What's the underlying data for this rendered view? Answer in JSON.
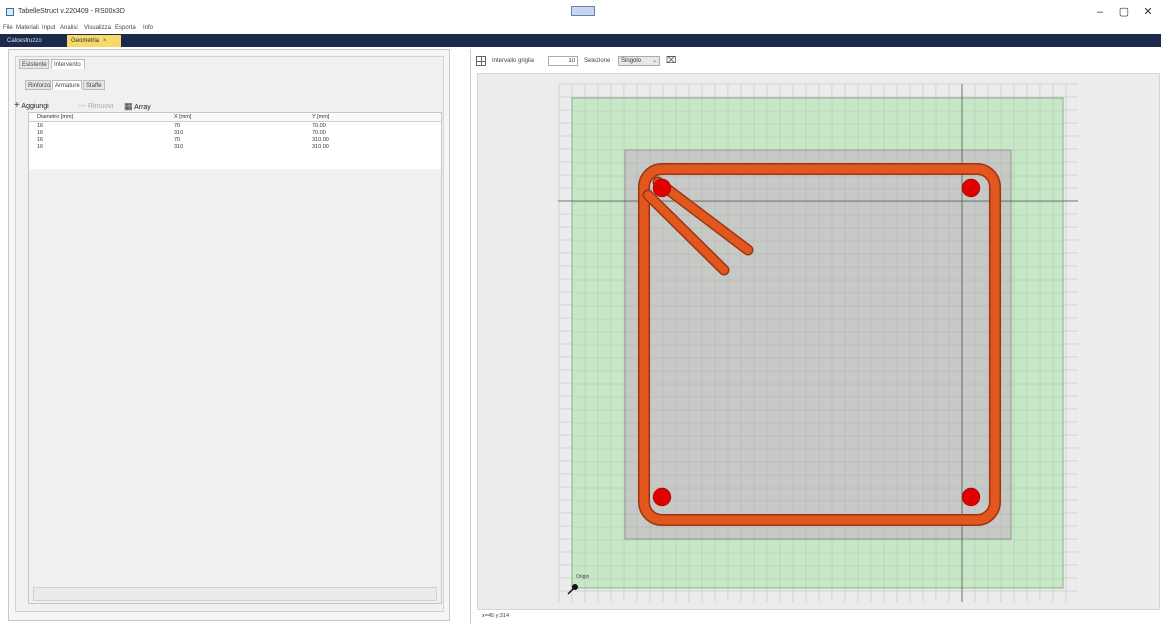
{
  "window": {
    "title": "TabelleStruct v.220409 - RS00x3D",
    "center_badge": "",
    "minimize": "–",
    "maximize": "▢",
    "close": "✕"
  },
  "menu": [
    "File",
    "Materiali",
    "Input",
    "Analisi",
    "Visualizza",
    "Esporta",
    "Info"
  ],
  "doc_tabs": {
    "calcestruzzo": "Calcestruzzo",
    "geometria": "Geometria",
    "geometria_close": "×"
  },
  "left": {
    "outer_tabs": [
      "Esistente",
      "Intervento"
    ],
    "inner_tabs": [
      "Rinforzo",
      "Armature",
      "Staffe"
    ],
    "toolbar": {
      "add": "Aggiungi",
      "remove": "Rimuovi",
      "array": "Array"
    },
    "table": {
      "columns": [
        "Diametro [mm]",
        "X [mm]",
        "Y [mm]"
      ],
      "rows": [
        [
          "16",
          "70",
          "70.00"
        ],
        [
          "16",
          "310",
          "70.00"
        ],
        [
          "16",
          "70",
          "310.00"
        ],
        [
          "16",
          "310",
          "310.00"
        ]
      ]
    }
  },
  "right": {
    "toolbar": {
      "grid_interval_label": "Intervallo griglia",
      "grid_interval_value": "10",
      "selection_label": "Selezione",
      "selection_value": "Singolo"
    },
    "origin_label": "Origin",
    "status_coords": "x=45 y:314"
  },
  "colors": {
    "outer_section": "#c7e8c7",
    "inner_section": "#c6c6c6",
    "stirrup": "#e2571e",
    "bar": "#e00000",
    "doc_tab_bar": "#1b2a4a",
    "active_doc_tab": "#f5d96b"
  },
  "section": {
    "bars": [
      [
        70,
        70
      ],
      [
        310,
        70
      ],
      [
        70,
        310
      ],
      [
        310,
        310
      ]
    ],
    "bar_diameter": 16
  }
}
